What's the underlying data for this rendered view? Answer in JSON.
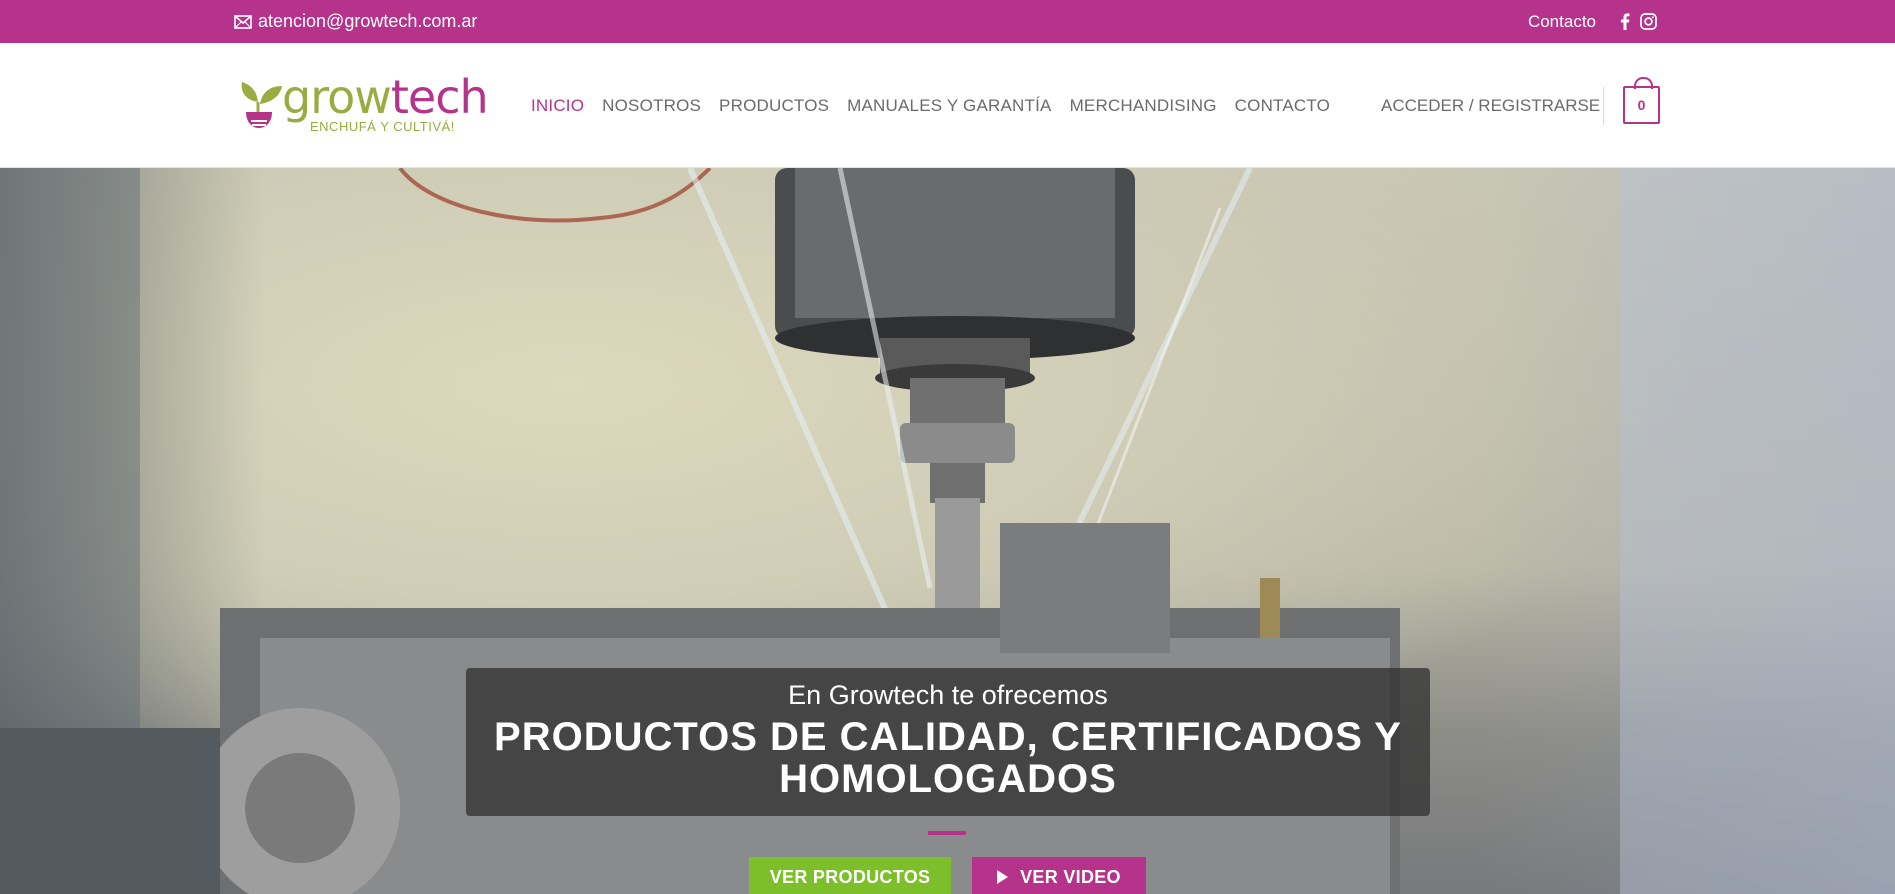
{
  "colors": {
    "brand_pink": "#b5338a",
    "brand_green": "#9aab42",
    "button_green": "#7cbf2a"
  },
  "topbar": {
    "email": "atencion@growtech.com.ar",
    "email_icon": "envelope-icon",
    "contact_label": "Contacto",
    "social_icons": [
      "facebook-icon",
      "instagram-icon"
    ]
  },
  "header": {
    "logo": {
      "word_grow": "grow",
      "word_tech": "tech",
      "tagline": "ENCHUFÁ Y CULTIVÁ!"
    },
    "nav": [
      {
        "label": "INICIO",
        "active": true
      },
      {
        "label": "NOSOTROS",
        "active": false
      },
      {
        "label": "PRODUCTOS",
        "active": false
      },
      {
        "label": "MANUALES Y GARANTÍA",
        "active": false
      },
      {
        "label": "MERCHANDISING",
        "active": false
      },
      {
        "label": "CONTACTO",
        "active": false
      }
    ],
    "login_label": "ACCEDER / REGISTRARSE",
    "cart_count": "0"
  },
  "hero": {
    "subtitle": "En Growtech te ofrecemos",
    "title": "PRODUCTOS DE CALIDAD, CERTIFICADOS Y HOMOLOGADOS",
    "buttons": {
      "products": "VER PRODUCTOS",
      "video": "VER VIDEO"
    }
  }
}
